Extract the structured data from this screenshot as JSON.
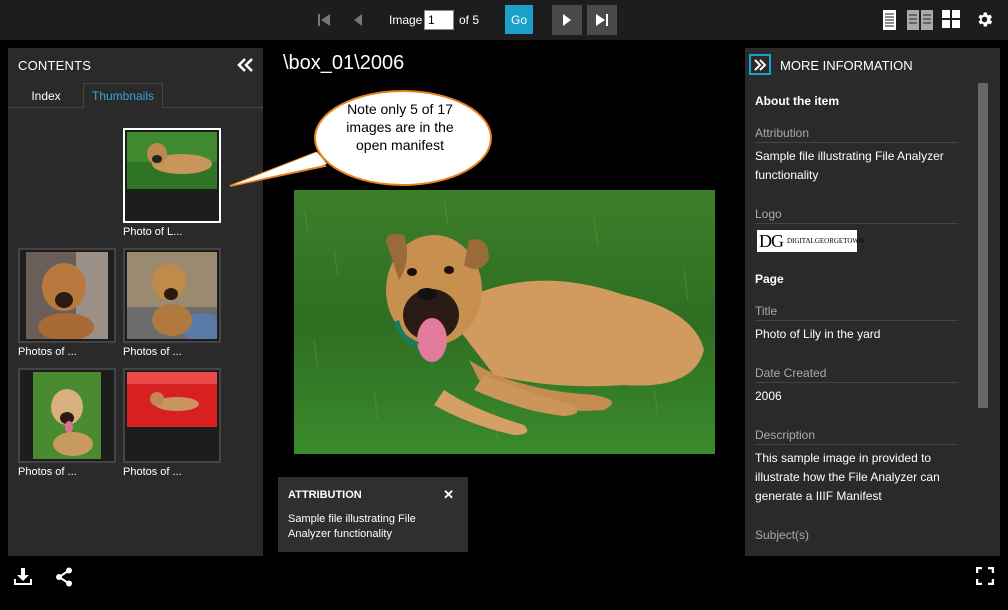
{
  "header": {
    "image_label": "Image",
    "current_page": "1",
    "of_label": "of 5",
    "go_label": "Go"
  },
  "contents": {
    "title": "CONTENTS",
    "tabs": [
      "Index",
      "Thumbnails"
    ],
    "thumbnails": [
      {
        "label": "Photo of L..."
      },
      {
        "label": "Photos of ..."
      },
      {
        "label": "Photos of ..."
      },
      {
        "label": "Photos of ..."
      },
      {
        "label": "Photos of ..."
      }
    ]
  },
  "viewer": {
    "breadcrumb": "\\box_01\\2006",
    "callout": "Note only 5 of 17 images are in the open manifest"
  },
  "attribution_box": {
    "title": "ATTRIBUTION",
    "close": "✕",
    "text": "Sample file illustrating File Analyzer functionality"
  },
  "more_info": {
    "title": "MORE INFORMATION",
    "about_heading": "About the item",
    "attribution_label": "Attribution",
    "attribution_value": "Sample file illustrating File Analyzer functionality",
    "logo_label": "Logo",
    "logo_text": "DG DIGITALGEORGETOWN",
    "page_heading": "Page",
    "title_label": "Title",
    "title_value": "Photo of Lily in the yard",
    "date_label": "Date Created",
    "date_value": "2006",
    "description_label": "Description",
    "description_value": "This sample image in provided to illustrate how the File Analyzer can generate a IIIF Manifest",
    "subjects_label": "Subject(s)"
  },
  "colors": {
    "accent": "#1ba1c9",
    "panel_bg": "#2a2a2a",
    "callout_border": "#e8821e"
  }
}
